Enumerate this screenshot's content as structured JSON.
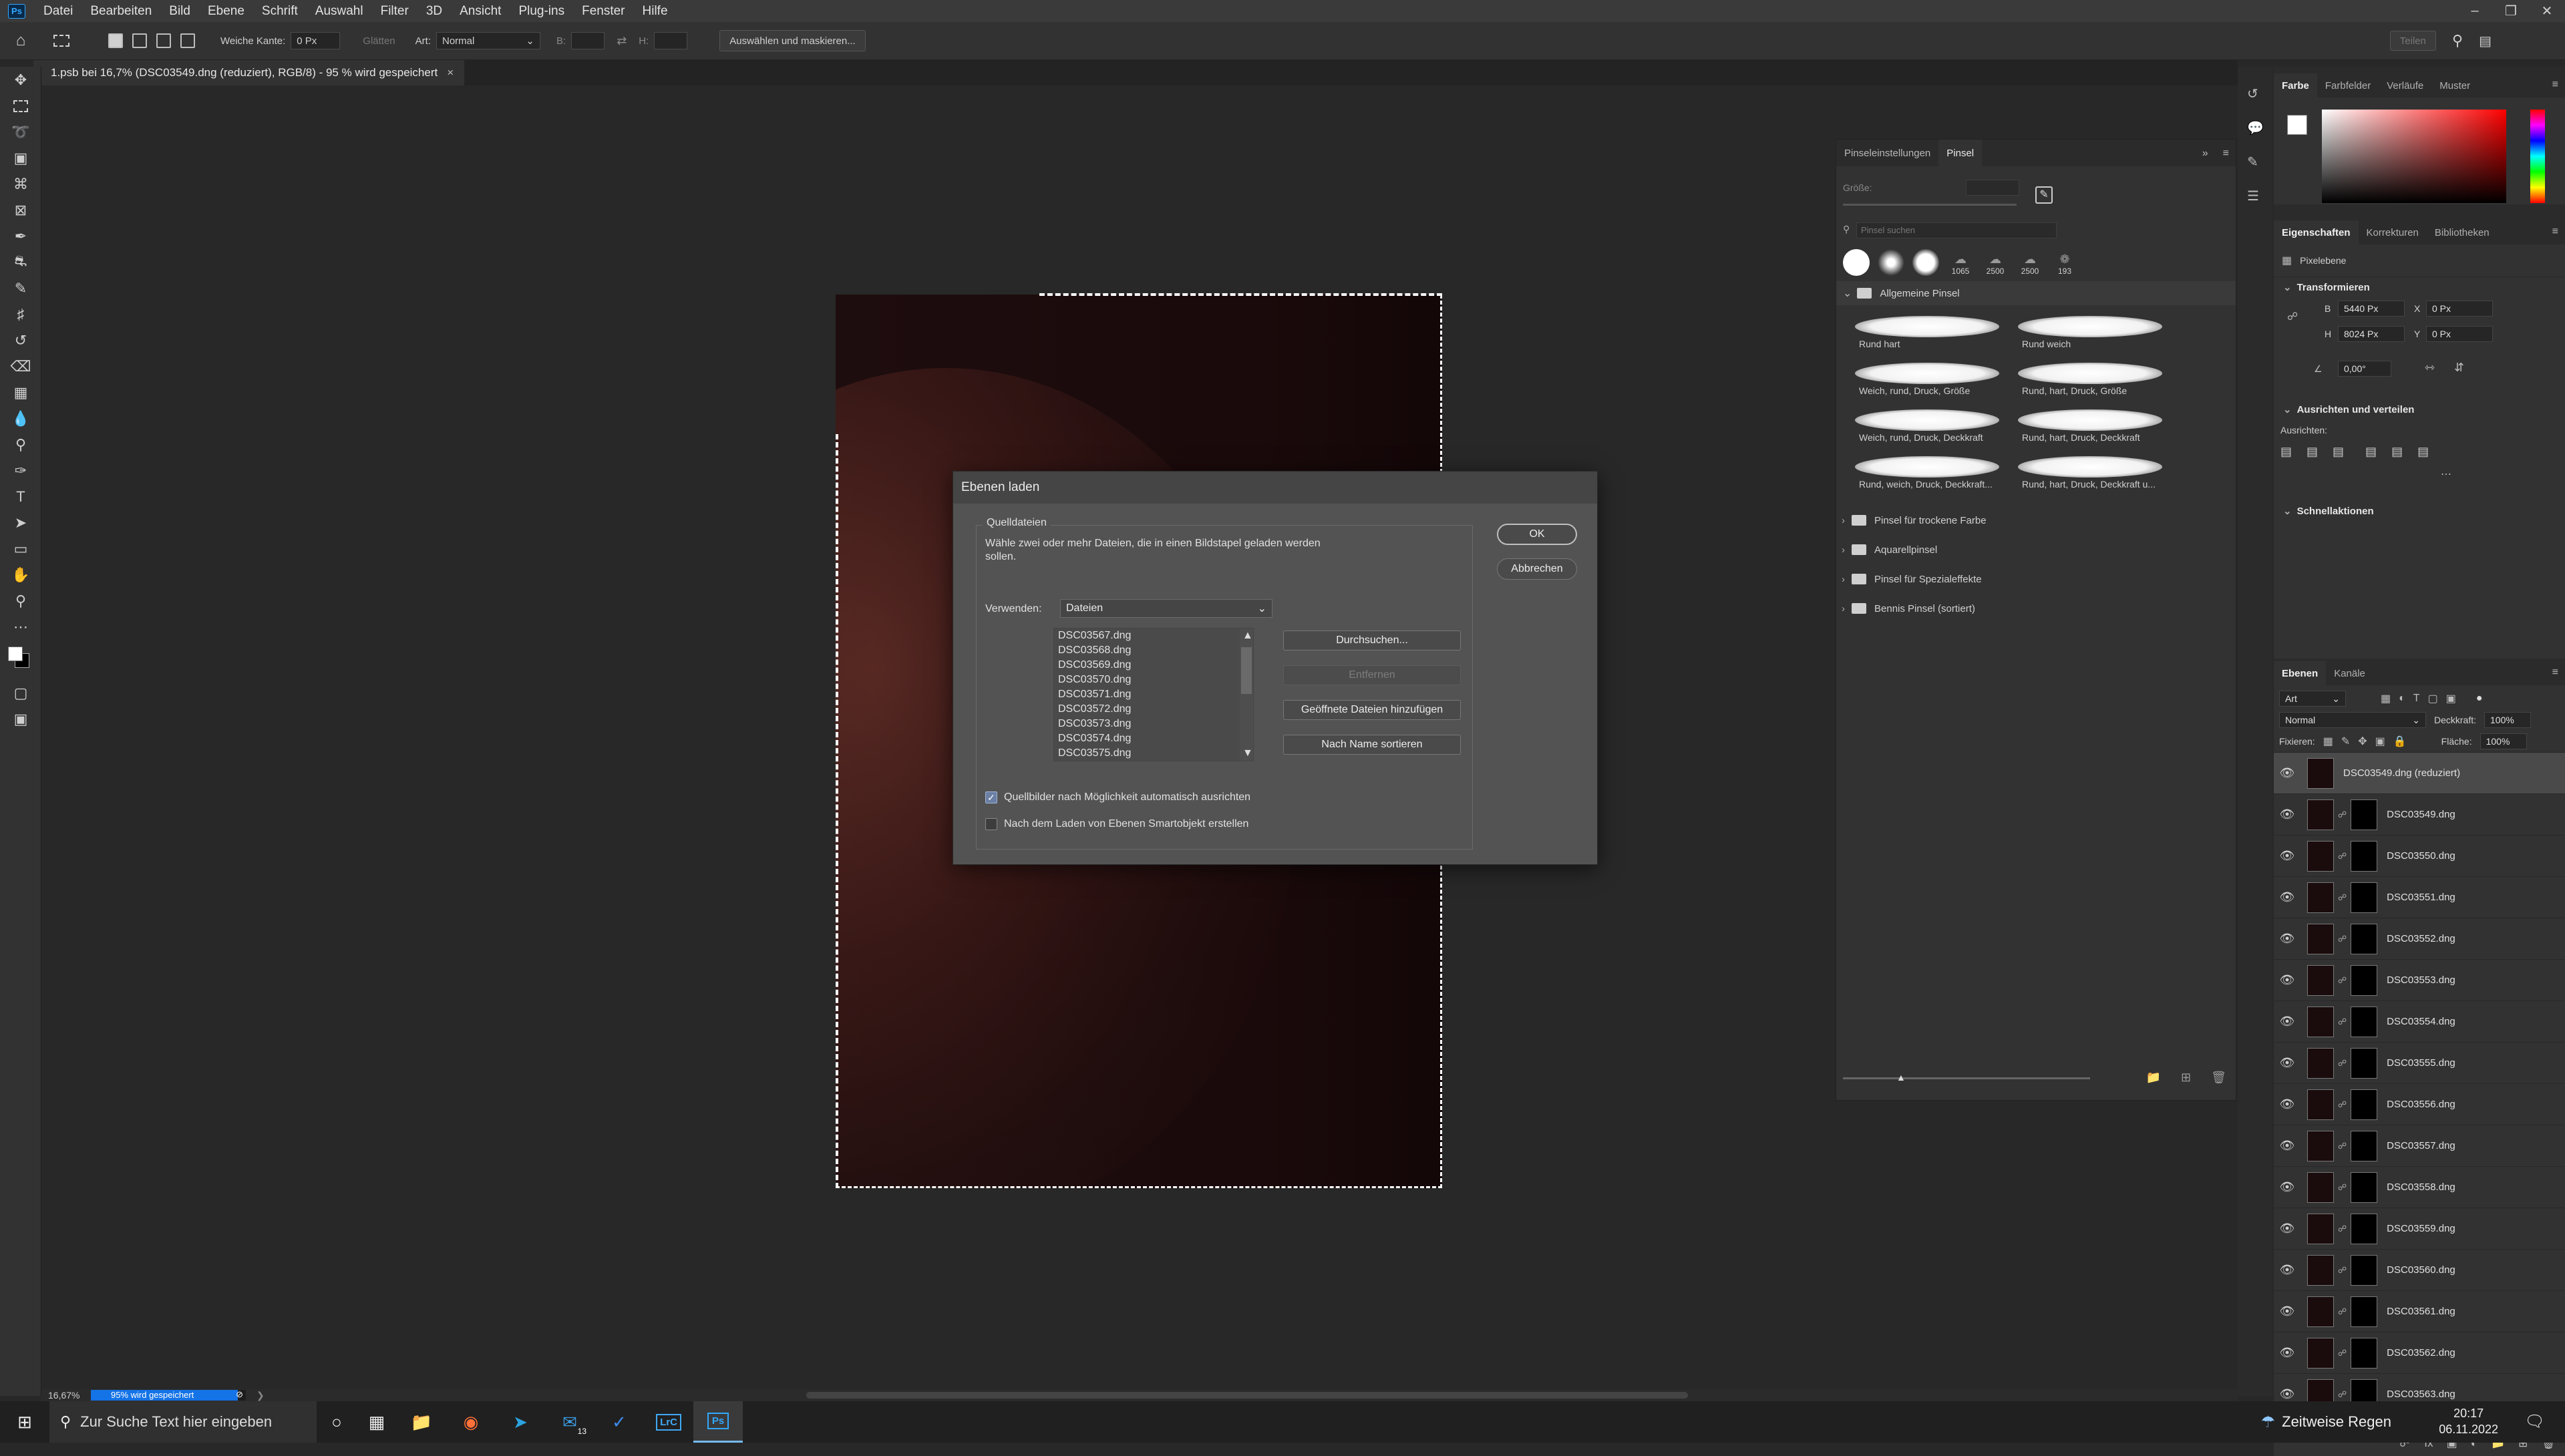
{
  "menubar": {
    "logo": "Ps",
    "items": [
      "Datei",
      "Bearbeiten",
      "Bild",
      "Ebene",
      "Schrift",
      "Auswahl",
      "Filter",
      "3D",
      "Ansicht",
      "Plug-ins",
      "Fenster",
      "Hilfe"
    ]
  },
  "options": {
    "feather_label": "Weiche Kante:",
    "feather_value": "0 Px",
    "antialias": "Glätten",
    "style_label": "Art:",
    "style_value": "Normal",
    "width_label": "B:",
    "height_label": "H:",
    "select_mask": "Auswählen und maskieren...",
    "share": "Teilen"
  },
  "document": {
    "tab_title": "1.psb bei 16,7% (DSC03549.dng (reduziert), RGB/8) - 95 % wird gespeichert",
    "zoom": "16,67%",
    "progress_label": "95% wird gespeichert",
    "progress": 0.95
  },
  "dialog": {
    "title": "Ebenen laden",
    "group_label": "Quelldateien",
    "description": "Wähle zwei oder mehr Dateien, die in einen Bildstapel geladen werden sollen.",
    "use_label": "Verwenden:",
    "use_value": "Dateien",
    "files": [
      "DSC03567.dng",
      "DSC03568.dng",
      "DSC03569.dng",
      "DSC03570.dng",
      "DSC03571.dng",
      "DSC03572.dng",
      "DSC03573.dng",
      "DSC03574.dng",
      "DSC03575.dng"
    ],
    "browse": "Durchsuchen...",
    "remove": "Entfernen",
    "add_open": "Geöffnete Dateien hinzufügen",
    "sort": "Nach Name sortieren",
    "ok": "OK",
    "cancel": "Abbrechen",
    "check_align": "Quellbilder nach Möglichkeit automatisch ausrichten",
    "check_align_on": true,
    "check_smart": "Nach dem Laden von Ebenen Smartobjekt erstellen",
    "check_smart_on": false
  },
  "brushes": {
    "tabs": [
      "Pinseleinstellungen",
      "Pinsel"
    ],
    "size_label": "Größe:",
    "search_placeholder": "Pinsel suchen",
    "preset_sizes": [
      "1065",
      "2500",
      "2500",
      "193"
    ],
    "general_folder": "Allgemeine Pinsel",
    "items": [
      "Rund hart",
      "Rund weich",
      "Weich, rund, Druck, Größe",
      "Rund, hart, Druck, Größe",
      "Weich, rund, Druck, Deckkraft",
      "Rund, hart, Druck, Deckkraft",
      "Rund, weich, Druck, Deckkraft...",
      "Rund, hart, Druck, Deckkraft u..."
    ],
    "folders": [
      "Pinsel für trockene Farbe",
      "Aquarellpinsel",
      "Pinsel für Spezialeffekte",
      "Bennis Pinsel (sortiert)"
    ]
  },
  "color_panel": {
    "tabs": [
      "Farbe",
      "Farbfelder",
      "Verläufe",
      "Muster"
    ]
  },
  "properties": {
    "tabs": [
      "Eigenschaften",
      "Korrekturen",
      "Bibliotheken"
    ],
    "kind": "Pixelebene",
    "transform_title": "Transformieren",
    "w_label": "B",
    "w_value": "5440 Px",
    "h_label": "H",
    "h_value": "8024 Px",
    "x_label": "X",
    "x_value": "0 Px",
    "y_label": "Y",
    "y_value": "0 Px",
    "angle": "0,00°",
    "align_title": "Ausrichten und verteilen",
    "align_label": "Ausrichten:",
    "quick_title": "Schnellaktionen"
  },
  "layers": {
    "tabs": [
      "Ebenen",
      "Kanäle"
    ],
    "filter_value": "Art",
    "blend_mode": "Normal",
    "opacity_label": "Deckkraft:",
    "opacity_value": "100%",
    "lock_label": "Fixieren:",
    "fill_label": "Fläche:",
    "fill_value": "100%",
    "items": [
      {
        "name": "DSC03549.dng (reduziert)",
        "selected": true,
        "mask": false
      },
      {
        "name": "DSC03549.dng",
        "selected": false,
        "mask": true
      },
      {
        "name": "DSC03550.dng",
        "selected": false,
        "mask": true
      },
      {
        "name": "DSC03551.dng",
        "selected": false,
        "mask": true
      },
      {
        "name": "DSC03552.dng",
        "selected": false,
        "mask": true
      },
      {
        "name": "DSC03553.dng",
        "selected": false,
        "mask": true
      },
      {
        "name": "DSC03554.dng",
        "selected": false,
        "mask": true
      },
      {
        "name": "DSC03555.dng",
        "selected": false,
        "mask": true
      },
      {
        "name": "DSC03556.dng",
        "selected": false,
        "mask": true
      },
      {
        "name": "DSC03557.dng",
        "selected": false,
        "mask": true
      },
      {
        "name": "DSC03558.dng",
        "selected": false,
        "mask": true
      },
      {
        "name": "DSC03559.dng",
        "selected": false,
        "mask": true
      },
      {
        "name": "DSC03560.dng",
        "selected": false,
        "mask": true
      },
      {
        "name": "DSC03561.dng",
        "selected": false,
        "mask": true
      },
      {
        "name": "DSC03562.dng",
        "selected": false,
        "mask": true
      },
      {
        "name": "DSC03563.dng",
        "selected": false,
        "mask": true
      }
    ]
  },
  "taskbar": {
    "search_placeholder": "Zur Suche Text hier eingeben",
    "weather": "Zeitweise Regen",
    "time": "20:17",
    "date": "06.11.2022",
    "mail_badge": "13",
    "lrc": "LrC",
    "ps": "Ps"
  }
}
